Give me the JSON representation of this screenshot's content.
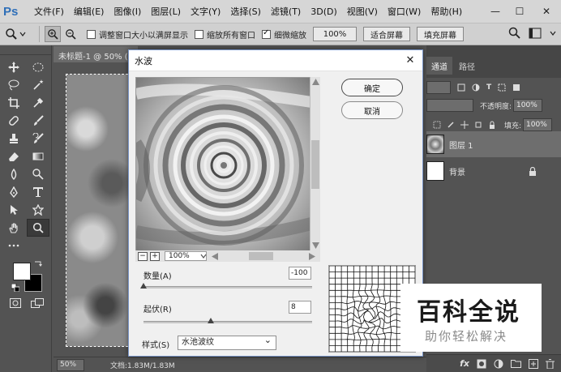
{
  "app": {
    "logo": "Ps"
  },
  "menu": [
    "文件(F)",
    "编辑(E)",
    "图像(I)",
    "图层(L)",
    "文字(Y)",
    "选择(S)",
    "滤镜(T)",
    "3D(D)",
    "视图(V)",
    "窗口(W)",
    "帮助(H)"
  ],
  "window_controls": {
    "minimize": "—",
    "maximize": "☐",
    "close": "✕"
  },
  "options": {
    "resize_windows_label": "调整窗口大小以满屏显示",
    "resize_windows_checked": false,
    "zoom_all_label": "缩放所有窗口",
    "zoom_all_checked": false,
    "scrubby_zoom_label": "细微缩放",
    "scrubby_zoom_checked": true,
    "btn_100": "100%",
    "btn_fit": "适合屏幕",
    "btn_fill": "填充屏幕"
  },
  "document": {
    "tab_title": "未标题-1 @ 50% (",
    "zoom": "50%",
    "doc_info": "文档:1.83M/1.83M"
  },
  "panels": {
    "tabs": [
      "通道",
      "路径"
    ],
    "opacity_label": "不透明度:",
    "opacity_value": "100%",
    "fill_label": "填充:",
    "fill_value": "100%",
    "layers": [
      {
        "name": "图层 1",
        "selected": true
      },
      {
        "name": "背景",
        "selected": false
      }
    ],
    "footer_fx": "fx"
  },
  "dialog": {
    "title": "水波",
    "ok": "确定",
    "cancel": "取消",
    "preview_zoom": "100%",
    "amount_label": "数量(A)",
    "amount_value": "-100",
    "amount_fraction": 0.0,
    "ridges_label": "起伏(R)",
    "ridges_value": "8",
    "ridges_fraction": 0.4,
    "style_label": "样式(S)",
    "style_value": "水池波纹"
  },
  "watermark": {
    "title": "百科全说",
    "subtitle": "助你轻松解决"
  }
}
